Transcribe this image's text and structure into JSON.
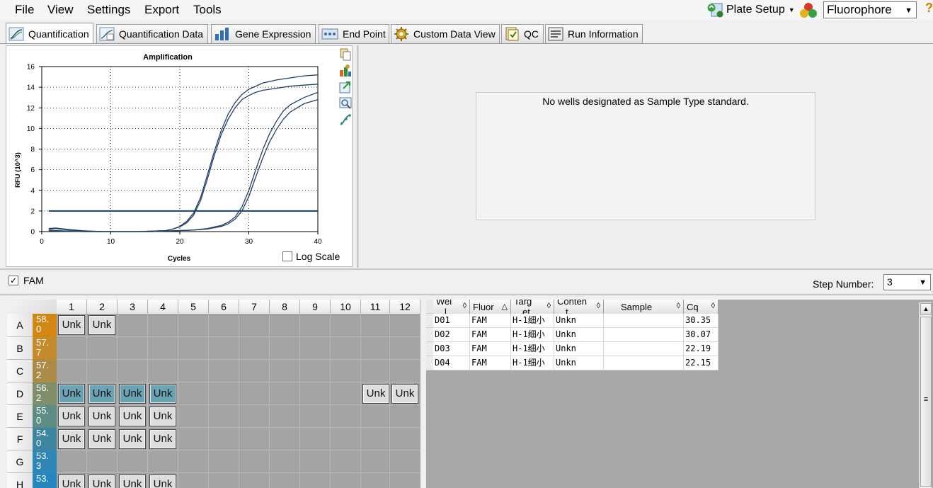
{
  "menu": {
    "items": [
      "File",
      "View",
      "Settings",
      "Export",
      "Tools"
    ]
  },
  "toolbar": {
    "plate_setup_label": "Plate Setup",
    "fluorophore_value": "Fluorophore",
    "help_glyph": "?"
  },
  "tabs": [
    "Quantification",
    "Quantification Data",
    "Gene Expression",
    "End Point",
    "Custom Data View",
    "QC",
    "Run Information"
  ],
  "active_tab": "Quantification",
  "chart_data": {
    "type": "line",
    "title": "Amplification",
    "xlabel": "Cycles",
    "ylabel": "RFU (10^3)",
    "xlim": [
      0,
      40
    ],
    "ylim": [
      0,
      16
    ],
    "xticks": [
      0,
      10,
      20,
      30,
      40
    ],
    "yticks": [
      0,
      2,
      4,
      6,
      8,
      10,
      12,
      14,
      16
    ],
    "grid": "dotted",
    "threshold": 2.0,
    "series": [
      {
        "well": "D01",
        "x": [
          1,
          2,
          4,
          6,
          8,
          10,
          12,
          14,
          16,
          18,
          20,
          22,
          24,
          26,
          27,
          28,
          29,
          30,
          31,
          32,
          33,
          34,
          35,
          36,
          38,
          40
        ],
        "y": [
          0.05,
          0.05,
          0.02,
          0.0,
          0.0,
          0.0,
          0.0,
          0.0,
          0.0,
          0.05,
          0.1,
          0.15,
          0.3,
          0.6,
          0.9,
          1.4,
          2.4,
          4.0,
          6.0,
          7.9,
          9.5,
          10.7,
          11.7,
          12.3,
          13.0,
          13.5
        ]
      },
      {
        "well": "D02",
        "x": [
          1,
          2,
          4,
          6,
          8,
          10,
          12,
          14,
          16,
          18,
          20,
          22,
          24,
          26,
          27,
          28,
          29,
          30,
          31,
          32,
          33,
          34,
          35,
          36,
          38,
          40
        ],
        "y": [
          0.1,
          0.1,
          0.05,
          0.0,
          0.0,
          0.0,
          0.0,
          0.0,
          0.0,
          0.05,
          0.1,
          0.15,
          0.25,
          0.5,
          0.75,
          1.2,
          2.0,
          3.4,
          5.3,
          7.1,
          8.7,
          9.9,
          10.9,
          11.6,
          12.4,
          12.8
        ]
      },
      {
        "well": "D03",
        "x": [
          1,
          2,
          4,
          6,
          8,
          10,
          12,
          14,
          16,
          18,
          19,
          20,
          21,
          22,
          23,
          24,
          25,
          26,
          27,
          28,
          29,
          30,
          31,
          32,
          34,
          36,
          38,
          40
        ],
        "y": [
          0.2,
          0.3,
          0.15,
          0.05,
          0.0,
          0.0,
          0.0,
          0.0,
          0.05,
          0.1,
          0.25,
          0.5,
          1.0,
          1.8,
          3.3,
          5.5,
          7.8,
          9.8,
          11.4,
          12.5,
          13.3,
          13.8,
          14.1,
          14.4,
          14.7,
          14.9,
          15.1,
          15.2
        ]
      },
      {
        "well": "D04",
        "x": [
          1,
          2,
          4,
          6,
          8,
          10,
          12,
          14,
          16,
          18,
          19,
          20,
          21,
          22,
          23,
          24,
          25,
          26,
          27,
          28,
          29,
          30,
          31,
          32,
          34,
          36,
          38,
          40
        ],
        "y": [
          0.3,
          0.35,
          0.2,
          0.08,
          0.03,
          0.0,
          0.0,
          0.0,
          0.05,
          0.1,
          0.25,
          0.45,
          0.85,
          1.6,
          3.0,
          5.1,
          7.4,
          9.4,
          10.9,
          12.0,
          12.8,
          13.2,
          13.5,
          13.7,
          13.9,
          14.1,
          14.2,
          14.3
        ]
      }
    ]
  },
  "log_scale_label": "Log Scale",
  "standard_curve_message": "No wells designated as Sample Type standard.",
  "fam_label": "FAM",
  "step_number": {
    "label": "Step Number:",
    "value": "3"
  },
  "plate": {
    "columns": [
      "1",
      "2",
      "3",
      "4",
      "5",
      "6",
      "7",
      "8",
      "9",
      "10",
      "11",
      "12"
    ],
    "rows": [
      {
        "label": "A",
        "temp_line1": "58.",
        "temp_line2": "0",
        "color": "#d28714"
      },
      {
        "label": "B",
        "temp_line1": "57.",
        "temp_line2": "7",
        "color": "#c48a2e"
      },
      {
        "label": "C",
        "temp_line1": "57.",
        "temp_line2": "2",
        "color": "#ac8a48"
      },
      {
        "label": "D",
        "temp_line1": "56.",
        "temp_line2": "2",
        "color": "#7f8f6c"
      },
      {
        "label": "E",
        "temp_line1": "55.",
        "temp_line2": "0",
        "color": "#5f8c84"
      },
      {
        "label": "F",
        "temp_line1": "54.",
        "temp_line2": "0",
        "color": "#3d86a0"
      },
      {
        "label": "G",
        "temp_line1": "53.",
        "temp_line2": "3",
        "color": "#2f86b8"
      },
      {
        "label": "H",
        "temp_line1": "53.",
        "temp_line2": "",
        "color": "#2686bf"
      }
    ],
    "wells": [
      {
        "row": 0,
        "col": 0,
        "label": "Unk",
        "state": "unsel"
      },
      {
        "row": 0,
        "col": 1,
        "label": "Unk",
        "state": "unsel"
      },
      {
        "row": 3,
        "col": 0,
        "label": "Unk",
        "state": "sel"
      },
      {
        "row": 3,
        "col": 1,
        "label": "Unk",
        "state": "sel"
      },
      {
        "row": 3,
        "col": 2,
        "label": "Unk",
        "state": "sel"
      },
      {
        "row": 3,
        "col": 3,
        "label": "Unk",
        "state": "sel"
      },
      {
        "row": 3,
        "col": 10,
        "label": "Unk",
        "state": "unsel"
      },
      {
        "row": 3,
        "col": 11,
        "label": "Unk",
        "state": "unsel"
      },
      {
        "row": 4,
        "col": 0,
        "label": "Unk",
        "state": "unsel"
      },
      {
        "row": 4,
        "col": 1,
        "label": "Unk",
        "state": "unsel"
      },
      {
        "row": 4,
        "col": 2,
        "label": "Unk",
        "state": "unsel"
      },
      {
        "row": 4,
        "col": 3,
        "label": "Unk",
        "state": "unsel"
      },
      {
        "row": 5,
        "col": 0,
        "label": "Unk",
        "state": "unsel"
      },
      {
        "row": 5,
        "col": 1,
        "label": "Unk",
        "state": "unsel"
      },
      {
        "row": 5,
        "col": 2,
        "label": "Unk",
        "state": "unsel"
      },
      {
        "row": 5,
        "col": 3,
        "label": "Unk",
        "state": "unsel"
      },
      {
        "row": 7,
        "col": 0,
        "label": "Unk",
        "state": "unsel"
      },
      {
        "row": 7,
        "col": 1,
        "label": "Unk",
        "state": "unsel"
      },
      {
        "row": 7,
        "col": 2,
        "label": "Unk",
        "state": "unsel"
      },
      {
        "row": 7,
        "col": 3,
        "label": "Unk",
        "state": "unsel"
      }
    ]
  },
  "results_table": {
    "headers": [
      {
        "line1": "Wel",
        "line2": "l"
      },
      {
        "line1": "Fluor",
        "line2": ""
      },
      {
        "line1": "Targ",
        "line2": "et"
      },
      {
        "line1": "Conten",
        "line2": "t"
      },
      {
        "line1": "Sample",
        "line2": ""
      },
      {
        "line1": "Cq",
        "line2": ""
      }
    ],
    "rows": [
      {
        "well": "D01",
        "fluor": "FAM",
        "target": "H-1细小",
        "content": "Unkn",
        "sample": "",
        "cq": "30.35"
      },
      {
        "well": "D02",
        "fluor": "FAM",
        "target": "H-1细小",
        "content": "Unkn",
        "sample": "",
        "cq": "30.07"
      },
      {
        "well": "D03",
        "fluor": "FAM",
        "target": "H-1细小",
        "content": "Unkn",
        "sample": "",
        "cq": "22.19"
      },
      {
        "well": "D04",
        "fluor": "FAM",
        "target": "H-1细小",
        "content": "Unkn",
        "sample": "",
        "cq": "22.15"
      }
    ]
  }
}
